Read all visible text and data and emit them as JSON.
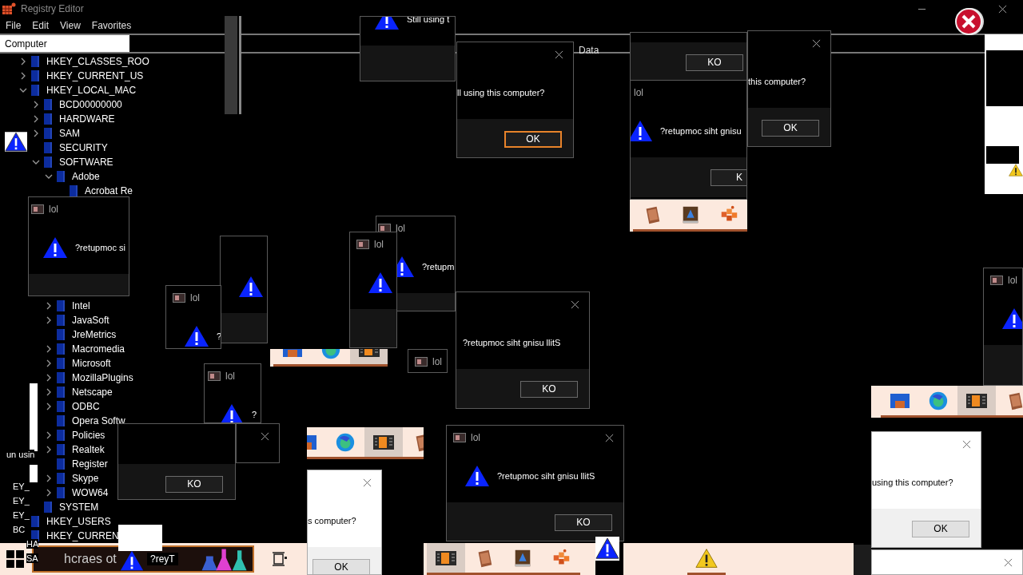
{
  "registry_editor": {
    "title": "Registry Editor",
    "menu": [
      "File",
      "Edit",
      "View",
      "Favorites"
    ],
    "address": "Computer",
    "column_header": "Data",
    "tree": [
      {
        "label": "HKEY_CLASSES_ROO",
        "expandable": true,
        "expanded": false
      },
      {
        "label": "HKEY_CURRENT_US",
        "expandable": true,
        "expanded": false
      },
      {
        "label": "HKEY_LOCAL_MAC",
        "expandable": true,
        "expanded": true,
        "children": [
          {
            "label": "BCD00000000",
            "expandable": true,
            "expanded": false
          },
          {
            "label": "HARDWARE",
            "expandable": true,
            "expanded": false
          },
          {
            "label": "SAM",
            "expandable": true,
            "expanded": false
          },
          {
            "label": "SECURITY",
            "expandable": false
          },
          {
            "label": "SOFTWARE",
            "expandable": true,
            "expanded": true,
            "children": [
              {
                "label": "Adobe",
                "expandable": true,
                "expanded": true,
                "children": [
                  {
                    "label": "Acrobat Re",
                    "expandable": false
                  }
                ]
              },
              {
                "label": "Intel",
                "expandable": true,
                "expanded": false
              },
              {
                "label": "JavaSoft",
                "expandable": true,
                "expanded": false
              },
              {
                "label": "JreMetrics",
                "expandable": false
              },
              {
                "label": "Macromedia",
                "expandable": true,
                "expanded": false
              },
              {
                "label": "Microsoft",
                "expandable": true,
                "expanded": false
              },
              {
                "label": "MozillaPlugins",
                "expandable": true,
                "expanded": false
              },
              {
                "label": "Netscape",
                "expandable": true,
                "expanded": false
              },
              {
                "label": "ODBC",
                "expandable": true,
                "expanded": false
              },
              {
                "label": "Opera Softw",
                "expandable": false
              },
              {
                "label": "Policies",
                "expandable": true,
                "expanded": false
              },
              {
                "label": "Realtek",
                "expandable": true,
                "expanded": false
              },
              {
                "label": "Register",
                "expandable": false
              },
              {
                "label": "Skype",
                "expandable": true,
                "expanded": false
              },
              {
                "label": "WOW64",
                "expandable": true,
                "expanded": false
              }
            ]
          },
          {
            "label": "SYSTEM",
            "expandable": false
          }
        ]
      },
      {
        "label": "HKEY_USERS",
        "expandable": false
      },
      {
        "label": "HKEY_CURREN",
        "expandable": false
      }
    ]
  },
  "dialogs": [
    {
      "light": false,
      "icon": true,
      "message": "Still using t"
    },
    {
      "light": false,
      "close": true,
      "message": "ll using this computer?",
      "button": {
        "label": "OK",
        "focused": true
      }
    },
    {
      "light": false,
      "button": {
        "label": "KO",
        "focused": false
      }
    },
    {
      "light": false,
      "title": "lol",
      "icon": true,
      "message": "?retupmoc siht gnisu",
      "button": {
        "label": "K",
        "focused": false
      }
    },
    {
      "light": false,
      "close": true,
      "message": "this computer?",
      "button": {
        "label": "OK",
        "focused": false
      }
    },
    {
      "light": false,
      "title": "lol",
      "icon": true,
      "message": "?retupmoc si"
    },
    {
      "light": false,
      "title": "lol",
      "icon": true
    },
    {
      "light": false,
      "title": "lol",
      "icon": true,
      "message": "?retupm"
    },
    {
      "light": false,
      "icon": true
    },
    {
      "light": false,
      "title": "lol",
      "icon": true,
      "message": "?"
    },
    {
      "light": false,
      "close": true,
      "message": "?retupmoc siht gnisu llitS",
      "button": {
        "label": "KO",
        "focused": false
      }
    },
    {
      "light": false,
      "title": "lol",
      "icon": true,
      "message": "?"
    },
    {
      "light": false,
      "title": "lol"
    },
    {
      "light": false,
      "icon": false,
      "button": {
        "label": "KO",
        "focused": false
      }
    },
    {
      "light": false,
      "close": true,
      "icon": false
    },
    {
      "light": false,
      "title": "lol",
      "close": true,
      "icon": true,
      "message": "?retupmoc siht gnisu llitS",
      "button": {
        "label": "KO",
        "focused": false
      }
    },
    {
      "light": true,
      "close": true,
      "message": "s computer?",
      "button": {
        "label": "OK",
        "focused": false
      }
    },
    {
      "light": true,
      "close": true,
      "message": "using this computer?",
      "button": {
        "label": "OK",
        "focused": false
      }
    },
    {
      "light": true,
      "close": true
    },
    {
      "light": false,
      "title": "lol",
      "icon": true
    }
  ],
  "taskbar_strips": [
    {
      "items": [
        {
          "kind": "notebook",
          "selected": false
        },
        {
          "kind": "book",
          "selected": false
        },
        {
          "kind": "cubes",
          "selected": false
        }
      ]
    },
    {
      "items": [
        {
          "kind": "folder",
          "selected": false
        },
        {
          "kind": "firefox",
          "selected": false
        },
        {
          "kind": "media",
          "selected": true
        }
      ]
    },
    {
      "items": [
        {
          "kind": "folder",
          "selected": false
        },
        {
          "kind": "firefox",
          "selected": false
        },
        {
          "kind": "media",
          "selected": true
        },
        {
          "kind": "notebook",
          "selected": false
        }
      ]
    },
    {
      "items": [
        {
          "kind": "folder",
          "selected": false
        },
        {
          "kind": "firefox",
          "selected": false
        },
        {
          "kind": "media",
          "selected": true
        },
        {
          "kind": "notebook",
          "selected": false
        }
      ]
    },
    {
      "items": [
        {
          "kind": "media",
          "selected": true
        },
        {
          "kind": "notebook",
          "selected": false
        },
        {
          "kind": "book",
          "selected": false
        },
        {
          "kind": "cubes",
          "selected": false
        }
      ]
    },
    {
      "items": [
        {
          "kind": "warning",
          "selected": false
        }
      ]
    }
  ],
  "taskbar": {
    "search": {
      "placeholder": "hcraes ot"
    },
    "overlay_label": "?reyT"
  },
  "fragments": [
    "un usin",
    "EY_",
    "EY_",
    "EY_",
    "BC",
    "HA",
    "SA"
  ]
}
